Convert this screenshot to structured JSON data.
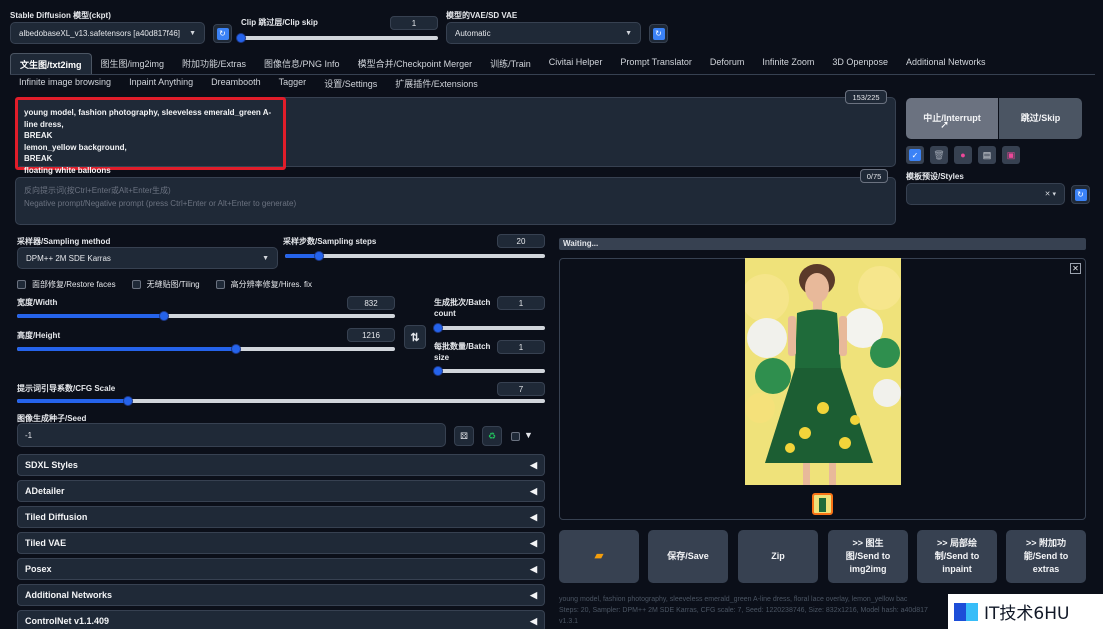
{
  "top": {
    "model_label": "Stable Diffusion 模型(ckpt)",
    "model_value": "albedobaseXL_v13.safetensors [a40d817f46]",
    "clip_label": "Clip 跳过层/Clip skip",
    "clip_value": "1",
    "clip_fraction": 0.0,
    "vae_label": "模型的VAE/SD VAE",
    "vae_value": "Automatic"
  },
  "tabs_row1": [
    "文生图/txt2img",
    "图生图/img2img",
    "附加功能/Extras",
    "图像信息/PNG Info",
    "模型合并/Checkpoint Merger",
    "训练/Train",
    "Civitai Helper",
    "Prompt Translator",
    "Deforum",
    "Infinite Zoom",
    "3D Openpose",
    "Additional Networks"
  ],
  "tabs_row2": [
    "Infinite image browsing",
    "Inpaint Anything",
    "Dreambooth",
    "Tagger",
    "设置/Settings",
    "扩展插件/Extensions"
  ],
  "prompt": {
    "lines": [
      "young model, fashion photography, sleeveless emerald_green A-line dress,",
      "BREAK",
      "lemon_yellow background,",
      "BREAK",
      "floating white balloons"
    ],
    "counter": "153/225"
  },
  "negative": {
    "lines": [
      "反向提示词(按Ctrl+Enter或Alt+Enter生成)",
      "Negative prompt/Negative prompt (press Ctrl+Enter or Alt+Enter to generate)"
    ],
    "counter": "0/75"
  },
  "gen": {
    "interrupt": "中止/Interrupt",
    "skip": "跳过/Skip",
    "styles_label": "模板预设/Styles"
  },
  "params": {
    "sampler_label": "采样器/Sampling method",
    "sampler_value": "DPM++ 2M SDE Karras",
    "steps_label": "采样步数/Sampling steps",
    "steps_value": "20",
    "steps_fraction": 0.13,
    "restore_faces": "面部修复/Restore faces",
    "tiling": "无缝贴图/Tiling",
    "hires": "高分辨率修复/Hires. fix",
    "width_label": "宽度/Width",
    "width_value": "832",
    "width_fraction": 0.39,
    "height_label": "高度/Height",
    "height_value": "1216",
    "height_fraction": 0.58,
    "batch_count_label": "生成批次/Batch count",
    "batch_count_value": "1",
    "batch_size_label": "每批数量/Batch size",
    "batch_size_value": "1",
    "cfg_label": "提示词引导系数/CFG Scale",
    "cfg_value": "7",
    "cfg_fraction": 0.21,
    "seed_label": "图像生成种子/Seed",
    "seed_value": "-1"
  },
  "accordions": [
    "SDXL Styles",
    "ADetailer",
    "Tiled Diffusion",
    "Tiled VAE",
    "Posex",
    "Additional Networks",
    "ControlNet v1.1.409"
  ],
  "output": {
    "status": "Waiting...",
    "save": "保存/Save",
    "zip": "Zip",
    "send_img2img": [
      ">> 图生",
      "图/Send to",
      "img2img"
    ],
    "send_inpaint": [
      ">> 局部绘",
      "制/Send to",
      "inpaint"
    ],
    "send_extras": [
      ">> 附加功",
      "能/Send to",
      "extras"
    ],
    "info_lines": [
      "young model, fashion photography, sleeveless emerald_green A-line dress, floral lace overlay, lemon_yellow bac",
      "Steps: 20, Sampler: DPM++ 2M SDE Karras, CFG scale: 7, Seed: 1220238746, Size: 832x1216, Model hash: a40d817",
      "v1.3.1"
    ]
  },
  "watermark": "IT技术6HU",
  "colors": {
    "accent": "#2563eb",
    "highlight": "#e11d2a",
    "bg": "#0b0f19",
    "panel": "#1f2937"
  }
}
